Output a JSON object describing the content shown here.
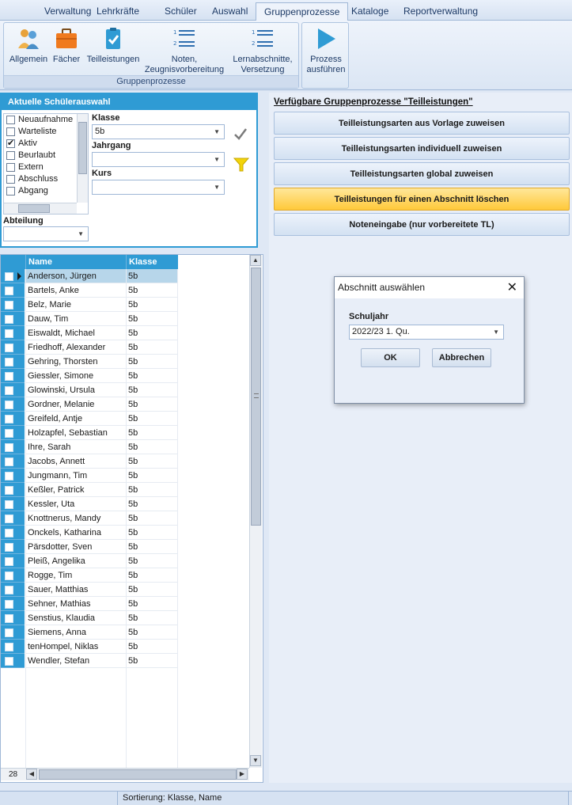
{
  "tabs": [
    "Verwaltung",
    "Lehrkräfte",
    "Schüler",
    "Auswahl",
    "Gruppenprozesse",
    "Kataloge",
    "Reportverwaltung"
  ],
  "active_tab": "Gruppenprozesse",
  "ribbon": {
    "group_label": "Gruppenprozesse",
    "buttons": {
      "allgemein": "Allgemein",
      "faecher": "Fächer",
      "teilleistungen": "Teilleistungen",
      "noten_l1": "Noten,",
      "noten_l2": "Zeugnisvorbereitung",
      "lern_l1": "Lernabschnitte,",
      "lern_l2": "Versetzung",
      "prozess_l1": "Prozess",
      "prozess_l2": "ausführen"
    }
  },
  "selection": {
    "header": "Aktuelle Schülerauswahl",
    "status_items": [
      {
        "label": "Neuaufnahme",
        "checked": false
      },
      {
        "label": "Warteliste",
        "checked": false
      },
      {
        "label": "Aktiv",
        "checked": true
      },
      {
        "label": "Beurlaubt",
        "checked": false
      },
      {
        "label": "Extern",
        "checked": false
      },
      {
        "label": "Abschluss",
        "checked": false
      },
      {
        "label": "Abgang",
        "checked": false
      }
    ],
    "klasse_label": "Klasse",
    "klasse_value": "5b",
    "jahrgang_label": "Jahrgang",
    "jahrgang_value": "",
    "kurs_label": "Kurs",
    "kurs_value": "",
    "abteilung_label": "Abteilung",
    "abteilung_value": ""
  },
  "grid": {
    "columns": [
      "Name",
      "Klasse"
    ],
    "rows": [
      [
        "Anderson, Jürgen",
        "5b"
      ],
      [
        "Bartels, Anke",
        "5b"
      ],
      [
        "Belz, Marie",
        "5b"
      ],
      [
        "Dauw, Tim",
        "5b"
      ],
      [
        "Eiswaldt, Michael",
        "5b"
      ],
      [
        "Friedhoff, Alexander",
        "5b"
      ],
      [
        "Gehring, Thorsten",
        "5b"
      ],
      [
        "Giessler, Simone",
        "5b"
      ],
      [
        "Glowinski, Ursula",
        "5b"
      ],
      [
        "Gordner, Melanie",
        "5b"
      ],
      [
        "Greifeld, Antje",
        "5b"
      ],
      [
        "Holzapfel, Sebastian",
        "5b"
      ],
      [
        "Ihre, Sarah",
        "5b"
      ],
      [
        "Jacobs, Annett",
        "5b"
      ],
      [
        "Jungmann, Tim",
        "5b"
      ],
      [
        "Keßler, Patrick",
        "5b"
      ],
      [
        "Kessler, Uta",
        "5b"
      ],
      [
        "Knottnerus, Mandy",
        "5b"
      ],
      [
        "Onckels, Katharina",
        "5b"
      ],
      [
        "Pärsdotter, Sven",
        "5b"
      ],
      [
        "Pleiß, Angelika",
        "5b"
      ],
      [
        "Rogge, Tim",
        "5b"
      ],
      [
        "Sauer, Matthias",
        "5b"
      ],
      [
        "Sehner, Mathias",
        "5b"
      ],
      [
        "Senstius, Klaudia",
        "5b"
      ],
      [
        "Siemens, Anna",
        "5b"
      ],
      [
        "tenHompel, Niklas",
        "5b"
      ],
      [
        "Wendler, Stefan",
        "5b"
      ]
    ],
    "selected_index": 0,
    "count": "28"
  },
  "processes": {
    "title": "Verfügbare Gruppenprozesse \"Teilleistungen\"",
    "buttons": [
      "Teilleistungsarten aus Vorlage zuweisen",
      "Teilleistungsarten individuell zuweisen",
      "Teilleistungsarten global zuweisen",
      "Teilleistungen für einen Abschnitt löschen",
      "Noteneingabe (nur vorbereitete TL)"
    ],
    "highlighted_index": 3
  },
  "dialog": {
    "title": "Abschnitt auswählen",
    "field_label": "Schuljahr",
    "field_value": "2022/23 1. Qu.",
    "ok": "OK",
    "cancel": "Abbrechen"
  },
  "statusbar": {
    "sort": "Sortierung: Klasse, Name"
  },
  "colors": {
    "accent": "#2f9bd4",
    "highlight": "#ffc93a"
  }
}
